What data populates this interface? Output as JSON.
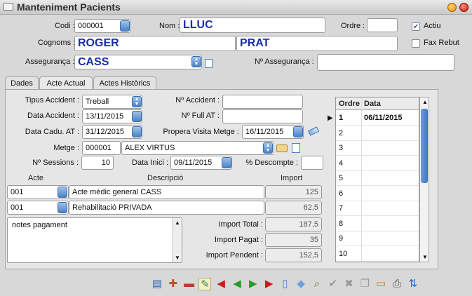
{
  "window": {
    "title": "Manteniment Pacients"
  },
  "header": {
    "codi_label": "Codi :",
    "codi_value": "000001",
    "nom_label": "Nom :",
    "nom_value": "LLUC",
    "ordre_label": "Ordre :",
    "ordre_value": "",
    "actiu_label": "Actiu",
    "actiu_checked": true,
    "cognoms_label": "Cognoms :",
    "cognom1": "ROGER",
    "cognom2": "PRAT",
    "fax_label": "Fax Rebut",
    "fax_checked": false,
    "asseguranca_label": "Assegurança :",
    "asseguranca_value": "CASS",
    "num_asseguranca_label": "Nº Assegurança :",
    "num_asseguranca_value": ""
  },
  "tabs": [
    {
      "label": "Dades",
      "active": false
    },
    {
      "label": "Acte Actual",
      "active": true
    },
    {
      "label": "Actes Històrics",
      "active": false
    }
  ],
  "form": {
    "tipus_accident_label": "Tipus Accident :",
    "tipus_accident_value": "Treball",
    "num_accident_label": "Nº Accident :",
    "num_accident_value": "",
    "data_accident_label": "Data Accident :",
    "data_accident_value": "13/11/2015",
    "num_full_at_label": "Nº Full AT :",
    "num_full_at_value": "",
    "data_caducitat_label": "Data Cadu. AT :",
    "data_caducitat_value": "31/12/2015",
    "propera_visita_label": "Propera Visita Metge :",
    "propera_visita_value": "16/11/2015",
    "metge_label": "Metge :",
    "metge_codi": "000001",
    "metge_nom": "ALEX VIRTUS",
    "sessions_label": "Nº Sessions :",
    "sessions_value": "10",
    "data_inici_label": "Data Inici :",
    "data_inici_value": "09/11/2015",
    "descompte_label": "% Descompte :",
    "descompte_value": ""
  },
  "actes": {
    "columns": [
      "Acte",
      "Descripció",
      "Import"
    ],
    "rows": [
      {
        "acte": "001",
        "descripcio": "Acte mèdic general CASS",
        "import": "125"
      },
      {
        "acte": "001",
        "descripcio": "Rehabilitació  PRIVADA",
        "import": "62,5"
      }
    ]
  },
  "notes": {
    "value": "notes pagament"
  },
  "totals": {
    "total_label": "Import Total :",
    "total_value": "187,5",
    "pagat_label": "Import Pagat :",
    "pagat_value": "35",
    "pendent_label": "Import Pendent :",
    "pendent_value": "152,5"
  },
  "grid": {
    "columns": [
      "Ordre",
      "Data"
    ],
    "rows": [
      {
        "ordre": "1",
        "data": "06/11/2015"
      },
      {
        "ordre": "2",
        "data": ""
      },
      {
        "ordre": "3",
        "data": ""
      },
      {
        "ordre": "4",
        "data": ""
      },
      {
        "ordre": "5",
        "data": ""
      },
      {
        "ordre": "6",
        "data": ""
      },
      {
        "ordre": "7",
        "data": ""
      },
      {
        "ordre": "8",
        "data": ""
      },
      {
        "ordre": "9",
        "data": ""
      },
      {
        "ordre": "10",
        "data": ""
      }
    ]
  },
  "toolbar": {
    "icons": [
      "list-icon",
      "add-record-icon",
      "remove-record-icon",
      "edit-record-icon",
      "first-icon",
      "previous-icon",
      "next-icon",
      "last-icon",
      "new-document-icon",
      "eraser-icon",
      "search-icon",
      "confirm-icon",
      "cancel-icon",
      "copy-icon",
      "book-icon",
      "print-icon",
      "sort-az-icon"
    ]
  },
  "colors": {
    "accent": "#4a82c6",
    "field_text_blue": "#1a2fa8",
    "nav_red": "#c81d1d",
    "nav_green": "#2a9a2a"
  }
}
